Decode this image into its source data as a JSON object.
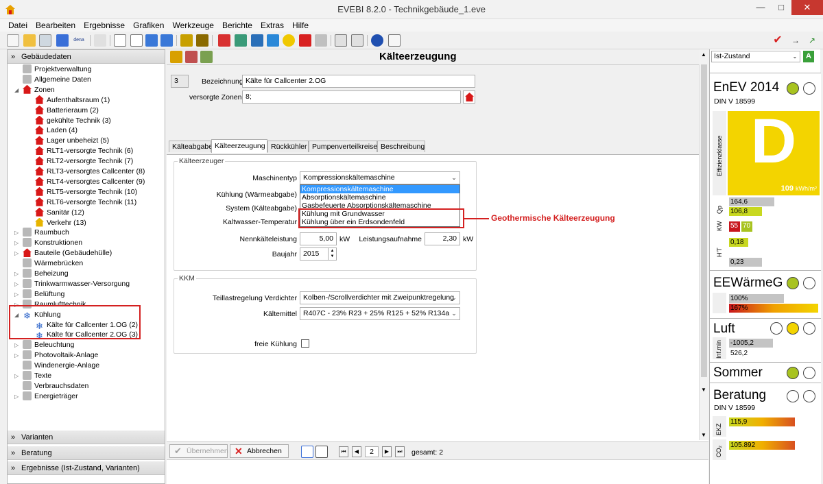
{
  "window": {
    "title": "EVEBI 8.2.0 - Technikgebäude_1.eve",
    "minimize": "—",
    "maximize": "□",
    "close": "✕"
  },
  "menu": [
    "Datei",
    "Bearbeiten",
    "Ergebnisse",
    "Grafiken",
    "Werkzeuge",
    "Berichte",
    "Extras",
    "Hilfe"
  ],
  "toolbar": {
    "dena_label": "dena"
  },
  "left": {
    "header": "Gebäudedaten",
    "tree": [
      {
        "label": "Projektverwaltung",
        "level": 1,
        "icon": "gear-house-icon"
      },
      {
        "label": "Allgemeine Daten",
        "level": 1,
        "icon": "document-icon"
      },
      {
        "label": "Zonen",
        "level": 1,
        "icon": "house-icon",
        "expanded": true
      },
      {
        "label": "Aufenthaltsraum (1)",
        "level": 2,
        "icon": "house-icon"
      },
      {
        "label": "Batterieraum (2)",
        "level": 2,
        "icon": "house-icon"
      },
      {
        "label": "gekühlte Technik (3)",
        "level": 2,
        "icon": "house-icon"
      },
      {
        "label": "Laden (4)",
        "level": 2,
        "icon": "house-icon"
      },
      {
        "label": "Lager unbeheizt (5)",
        "level": 2,
        "icon": "house-icon"
      },
      {
        "label": "RLT1-versorgte Technik (6)",
        "level": 2,
        "icon": "house-icon"
      },
      {
        "label": "RLT2-versorgte Technik (7)",
        "level": 2,
        "icon": "house-icon"
      },
      {
        "label": "RLT3-versorgtes Callcenter (8)",
        "level": 2,
        "icon": "house-icon"
      },
      {
        "label": "RLT4-versorgtes Callcenter (9)",
        "level": 2,
        "icon": "house-icon"
      },
      {
        "label": "RLT5-versorgte Technik (10)",
        "level": 2,
        "icon": "house-icon"
      },
      {
        "label": "RLT6-versorgte Technik (11)",
        "level": 2,
        "icon": "house-icon"
      },
      {
        "label": "Sanitär (12)",
        "level": 2,
        "icon": "house-icon"
      },
      {
        "label": "Verkehr (13)",
        "level": 2,
        "icon": "house-icon-yellow"
      },
      {
        "label": "Raumbuch",
        "level": 1,
        "icon": "book-icon",
        "collapsed": true
      },
      {
        "label": "Konstruktionen",
        "level": 1,
        "icon": "wall-icon",
        "collapsed": true
      },
      {
        "label": "Bauteile (Gebäudehülle)",
        "level": 1,
        "icon": "house-icon",
        "collapsed": true
      },
      {
        "label": "Wärmebrücken",
        "level": 1,
        "icon": "bridge-icon"
      },
      {
        "label": "Beheizung",
        "level": 1,
        "icon": "flame-icon",
        "collapsed": true
      },
      {
        "label": "Trinkwarmwasser-Versorgung",
        "level": 1,
        "icon": "drop-icon",
        "collapsed": true
      },
      {
        "label": "Belüftung",
        "level": 1,
        "icon": "fan-icon",
        "collapsed": true
      },
      {
        "label": "Raumlufttechnik",
        "level": 1,
        "icon": "duct-icon",
        "collapsed": true
      },
      {
        "label": "Kühlung",
        "level": 1,
        "icon": "snowflake-icon",
        "expanded": true
      },
      {
        "label": "Kälte für Callcenter 1.OG (2)",
        "level": 2,
        "icon": "snowflake-icon"
      },
      {
        "label": "Kälte für Callcenter 2.OG (3)",
        "level": 2,
        "icon": "snowflake-icon"
      },
      {
        "label": "Beleuchtung",
        "level": 1,
        "icon": "bulb-icon",
        "collapsed": true
      },
      {
        "label": "Photovoltaik-Anlage",
        "level": 1,
        "icon": "solar-icon",
        "collapsed": true
      },
      {
        "label": "Windenergie-Anlage",
        "level": 1,
        "icon": "wind-icon"
      },
      {
        "label": "Texte",
        "level": 1,
        "icon": "text-icon",
        "collapsed": true
      },
      {
        "label": "Verbrauchsdaten",
        "level": 1,
        "icon": "chart-icon"
      },
      {
        "label": "Energieträger",
        "level": 1,
        "icon": "barrel-icon",
        "collapsed": true
      }
    ],
    "sections": [
      "Varianten",
      "Beratung",
      "Ergebnisse (Ist-Zustand, Varianten)"
    ]
  },
  "center": {
    "header": "Kälteerzeugung",
    "number": "3",
    "bezeichnung_label": "Bezeichnung",
    "bezeichnung_value": "Kälte für Callcenter 2.OG",
    "zonen_label": "versorgte Zonen",
    "zonen_value": "8;",
    "tabs": [
      "Kälteabgabe",
      "Kälteerzeugung",
      "Rückkühler",
      "Pumpenverteilkreise",
      "Beschreibung"
    ],
    "group1": "Kälteerzeuger",
    "maschinentyp_label": "Maschinentyp",
    "maschinentyp_value": "Kompressionskältemaschine",
    "dropdown": [
      "Kompressionskältemaschine",
      "Absorptionskältemaschine",
      "Gasbefeuerte Absorptionskältemaschine",
      "Kühlung mit Grundwasser",
      "Kühlung über ein Erdsondenfeld"
    ],
    "kuehlung_label": "Kühlung (Wärmeabgabe)",
    "system_label": "System (Kälteabgabe)",
    "kaltwasser_label": "Kaltwasser-Temperatur",
    "nenn_label": "Nennkälteleistung",
    "nenn_value": "5,00",
    "nenn_unit": "kW",
    "leist_label": "Leistungsaufnahme",
    "leist_value": "2,30",
    "leist_unit": "kW",
    "baujahr_label": "Baujahr",
    "baujahr_value": "2015",
    "group2": "KKM",
    "teillast_label": "Teillastregelung Verdichter",
    "teillast_value": "Kolben-/Scrollverdichter mit Zweipunktregelung",
    "kaeltemittel_label": "Kältemittel",
    "kaeltemittel_value": "R407C - 23% R23 + 25% R125 + 52% R134a",
    "freie_label": "freie Kühlung",
    "annotation": "Geothermische Kälteerzeugung",
    "btn_uebernehmen": "Übernehmen",
    "btn_abbrechen": "Abbrechen",
    "page": "2",
    "gesamt": "gesamt: 2"
  },
  "right": {
    "select": "Ist-Zustand",
    "enev_title": "EnEV 2014",
    "enev_sub": "DIN V 18599",
    "effizienz_label": "Effizienzklasse",
    "class_letter": "D",
    "class_value": "109",
    "class_unit": "kWh/m²",
    "qp_label": "Qp",
    "qp_values": [
      "164,6",
      "106,8"
    ],
    "kw_label": "KW",
    "kw_values": [
      "55",
      "70"
    ],
    "ht_label": "H'T",
    "ht_values": [
      "0,18",
      "0,23"
    ],
    "ewg_title": "EEWärmeG",
    "ewg_values": [
      "100%",
      "167%"
    ],
    "luft_title": "Luft",
    "inf_label": "Inf.min",
    "luft_values": [
      "-1005,2",
      "526,2"
    ],
    "sommer_title": "Sommer",
    "beratung_title": "Beratung",
    "beratung_sub": "DIN V 18599",
    "ekz_label": "EKZ",
    "ekz_value": "115,9",
    "co2_label": "CO₂",
    "co2_value": "105.892"
  },
  "colors": {
    "class_yellow": "#f3d400",
    "green": "#a8c320",
    "red": "#c8161d",
    "highlight": "#d42020"
  }
}
